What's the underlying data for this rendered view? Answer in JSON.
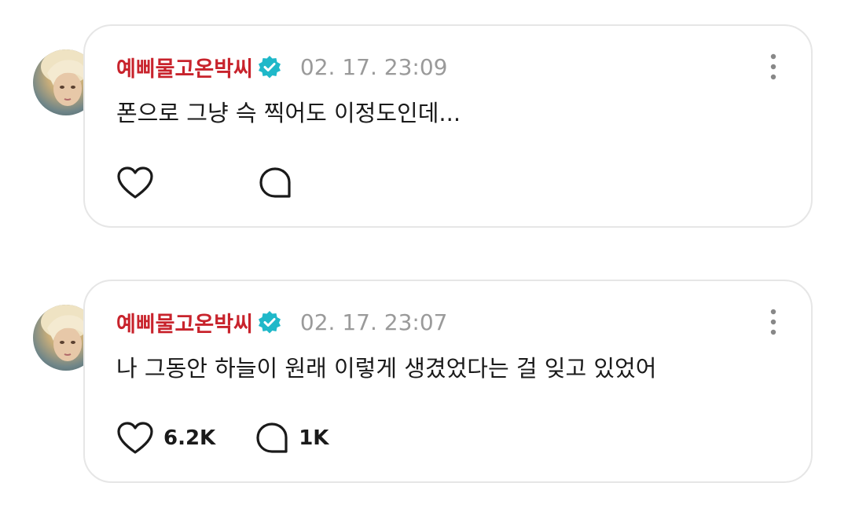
{
  "posts": [
    {
      "username": "예삐물고온박씨",
      "verified_icon": "verified-badge-icon",
      "timestamp": "02. 17. 23:09",
      "text": "폰으로 그냥 슥 찍어도 이정도인데...",
      "likes": "",
      "comments": ""
    },
    {
      "username": "예삐물고온박씨",
      "verified_icon": "verified-badge-icon",
      "timestamp": "02. 17. 23:07",
      "text": "나 그동안 하늘이 원래 이렇게 생겼었다는 걸 잊고 있었어",
      "likes": "6.2K",
      "comments": "1K"
    }
  ],
  "colors": {
    "username": "#c8232c",
    "verified": "#1fb8c9",
    "timestamp": "#9a9a9a",
    "card_border": "#e6e6e6"
  }
}
